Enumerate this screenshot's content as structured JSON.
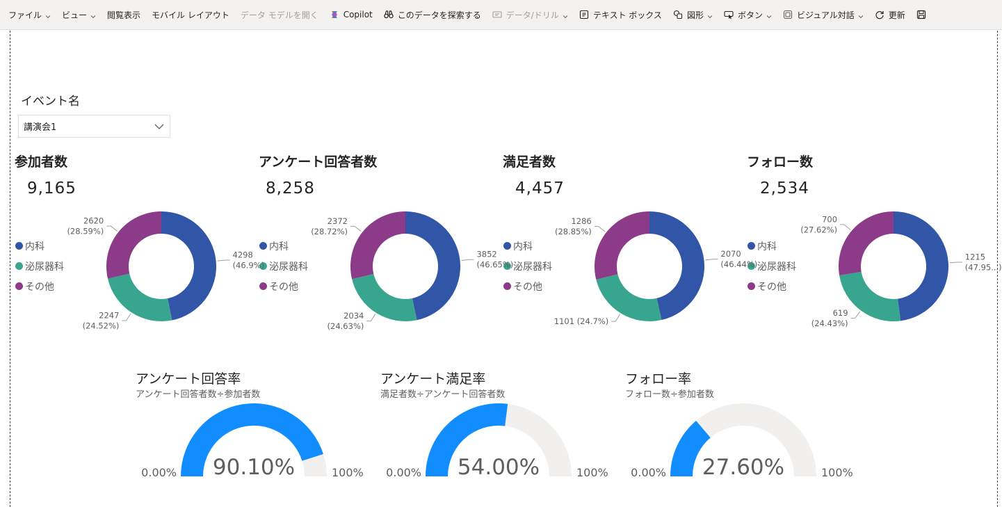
{
  "toolbar": {
    "items": [
      {
        "label": "ファイル",
        "icon": "",
        "chevron": true,
        "disabled": false
      },
      {
        "label": "ビュー",
        "icon": "",
        "chevron": true,
        "disabled": false
      },
      {
        "label": "閲覧表示",
        "icon": "",
        "chevron": false,
        "disabled": false
      },
      {
        "label": "モバイル レイアウト",
        "icon": "",
        "chevron": false,
        "disabled": false
      },
      {
        "label": "データ モデルを開く",
        "icon": "",
        "chevron": false,
        "disabled": true
      },
      {
        "label": "Copilot",
        "icon": "copilot-icon",
        "chevron": false,
        "disabled": false
      },
      {
        "label": "このデータを探索する",
        "icon": "binoculars-icon",
        "chevron": false,
        "disabled": false
      },
      {
        "label": "データ/ドリル",
        "icon": "drill-icon",
        "chevron": true,
        "disabled": true
      },
      {
        "label": "テキスト ボックス",
        "icon": "textbox-icon",
        "chevron": false,
        "disabled": false
      },
      {
        "label": "図形",
        "icon": "shapes-icon",
        "chevron": true,
        "disabled": false
      },
      {
        "label": "ボタン",
        "icon": "button-icon",
        "chevron": true,
        "disabled": false
      },
      {
        "label": "ビジュアル対話",
        "icon": "visual-interaction-icon",
        "chevron": true,
        "disabled": false
      },
      {
        "label": "更新",
        "icon": "refresh-icon",
        "chevron": false,
        "disabled": false
      },
      {
        "label": "",
        "icon": "save-icon",
        "chevron": false,
        "disabled": false
      }
    ]
  },
  "slicer": {
    "title": "イベント名",
    "selected": "講演会1"
  },
  "colors": {
    "naika": "#3155a7",
    "hinyoki": "#38a58f",
    "sonota": "#8b3b87",
    "gauge_fill": "#118dff",
    "gauge_track": "#f1f0ef"
  },
  "legend_labels": [
    "内科",
    "泌尿器科",
    "その他"
  ],
  "cards": [
    {
      "title": "参加者数",
      "value": "9,165",
      "labels": {
        "naika": [
          "4298",
          "(46.9%)"
        ],
        "hinyoki": [
          "2247",
          "(24.52%)"
        ],
        "sonota": [
          "2620",
          "(28.59%)"
        ]
      }
    },
    {
      "title": "アンケート回答者数",
      "value": "8,258",
      "labels": {
        "naika": [
          "3852",
          "(46.65%)"
        ],
        "hinyoki": [
          "2034",
          "(24.63%)"
        ],
        "sonota": [
          "2372",
          "(28.72%)"
        ]
      }
    },
    {
      "title": "満足者数",
      "value": "4,457",
      "labels": {
        "naika": [
          "2070",
          "(46.44%)"
        ],
        "hinyoki": [
          "1101 (24.7%)"
        ],
        "sonota": [
          "1286",
          "(28.85%)"
        ]
      }
    },
    {
      "title": "フォロー数",
      "value": "2,534",
      "labels": {
        "naika": [
          "1215",
          "(47.95...)"
        ],
        "hinyoki": [
          "619",
          "(24.43%)"
        ],
        "sonota": [
          "700",
          "(27.62%)"
        ]
      }
    }
  ],
  "gauges": [
    {
      "title": "アンケート回答率",
      "subtitle": "アンケート回答者数÷参加者数",
      "value_label": "90.10%",
      "min_label": "0.00%",
      "max_label": "100%"
    },
    {
      "title": "アンケート満足率",
      "subtitle": "満足者数÷アンケート回答者数",
      "value_label": "54.00%",
      "min_label": "0.00%",
      "max_label": "100%"
    },
    {
      "title": "フォロー率",
      "subtitle": "フォロー数÷参加者数",
      "value_label": "27.60%",
      "min_label": "0.00%",
      "max_label": "100%"
    }
  ],
  "chart_data": [
    {
      "type": "pie",
      "title": "参加者数",
      "categories": [
        "内科",
        "泌尿器科",
        "その他"
      ],
      "values": [
        4298,
        2247,
        2620
      ],
      "donut": true,
      "legend": "left"
    },
    {
      "type": "pie",
      "title": "アンケート回答者数",
      "categories": [
        "内科",
        "泌尿器科",
        "その他"
      ],
      "values": [
        3852,
        2034,
        2372
      ],
      "donut": true,
      "legend": "left"
    },
    {
      "type": "pie",
      "title": "満足者数",
      "categories": [
        "内科",
        "泌尿器科",
        "その他"
      ],
      "values": [
        2070,
        1101,
        1286
      ],
      "donut": true,
      "legend": "left"
    },
    {
      "type": "pie",
      "title": "フォロー数",
      "categories": [
        "内科",
        "泌尿器科",
        "その他"
      ],
      "values": [
        1215,
        619,
        700
      ],
      "donut": true,
      "legend": "left"
    },
    {
      "type": "gauge",
      "title": "アンケート回答率",
      "value": 90.1,
      "min": 0,
      "max": 100
    },
    {
      "type": "gauge",
      "title": "アンケート満足率",
      "value": 54.0,
      "min": 0,
      "max": 100
    },
    {
      "type": "gauge",
      "title": "フォロー率",
      "value": 27.6,
      "min": 0,
      "max": 100
    }
  ]
}
